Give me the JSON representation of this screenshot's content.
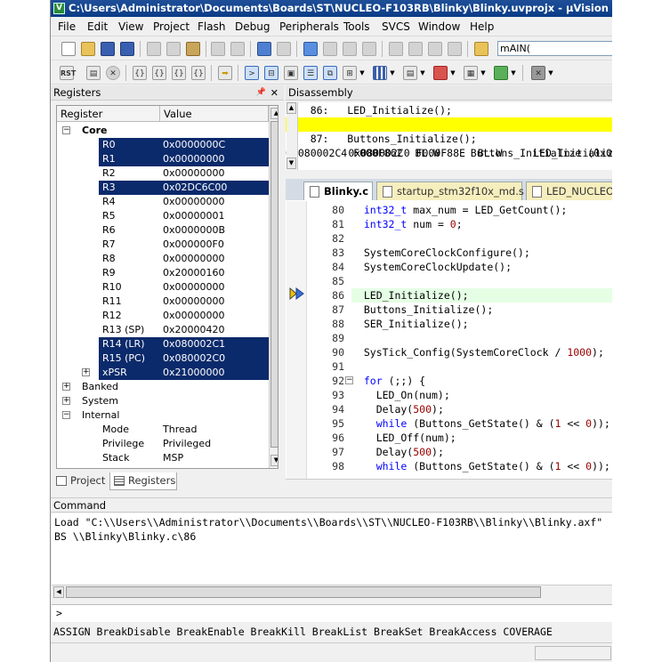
{
  "window": {
    "title": "C:\\Users\\Administrator\\Documents\\Boards\\ST\\NUCLEO-F103RB\\Blinky\\Blinky.uvprojx - µVision"
  },
  "menu": [
    "File",
    "Edit",
    "View",
    "Project",
    "Flash",
    "Debug",
    "Peripherals",
    "Tools",
    "SVCS",
    "Window",
    "Help"
  ],
  "toolbar": {
    "find_value": "mAIN(",
    "reset_label": "RST"
  },
  "registers_panel": {
    "title": "Registers",
    "col_register": "Register",
    "col_value": "Value",
    "core_label": "Core",
    "core": [
      {
        "name": "R0",
        "value": "0x0000000C",
        "selected": true
      },
      {
        "name": "R1",
        "value": "0x00000000",
        "selected": true
      },
      {
        "name": "R2",
        "value": "0x00000000",
        "selected": false
      },
      {
        "name": "R3",
        "value": "0x02DC6C00",
        "selected": true
      },
      {
        "name": "R4",
        "value": "0x00000000",
        "selected": false
      },
      {
        "name": "R5",
        "value": "0x00000001",
        "selected": false
      },
      {
        "name": "R6",
        "value": "0x0000000B",
        "selected": false
      },
      {
        "name": "R7",
        "value": "0x000000F0",
        "selected": false
      },
      {
        "name": "R8",
        "value": "0x00000000",
        "selected": false
      },
      {
        "name": "R9",
        "value": "0x20000160",
        "selected": false
      },
      {
        "name": "R10",
        "value": "0x00000000",
        "selected": false
      },
      {
        "name": "R11",
        "value": "0x00000000",
        "selected": false
      },
      {
        "name": "R12",
        "value": "0x00000000",
        "selected": false
      },
      {
        "name": "R13 (SP)",
        "value": "0x20000420",
        "selected": false
      },
      {
        "name": "R14 (LR)",
        "value": "0x080002C1",
        "selected": true
      },
      {
        "name": "R15 (PC)",
        "value": "0x080002C0",
        "selected": true
      },
      {
        "name": "xPSR",
        "value": "0x21000000",
        "selected": true
      }
    ],
    "groups": [
      "Banked",
      "System",
      "Internal"
    ],
    "internal": [
      {
        "name": "Mode",
        "value": "Thread"
      },
      {
        "name": "Privilege",
        "value": "Privileged"
      },
      {
        "name": "Stack",
        "value": "MSP"
      }
    ],
    "tabs": [
      "Project",
      "Registers"
    ]
  },
  "disassembly": {
    "title": "Disassembly",
    "lines": [
      "    86:   LED_Initialize();",
      "0x080002C0 F000F88E  BL.W     LED_Initialize (0x080003E0)",
      "    87:   Buttons_Initialize();",
      "0x080002C4 F000F862  BL.W     Buttons_Initialize (0x0800038C)"
    ]
  },
  "editor": {
    "tabs": [
      "Blinky.c",
      "startup_stm32f10x_md.s",
      "LED_NUCLEO_F103RB.c"
    ],
    "lines": [
      {
        "n": "80",
        "t": "  int32_t max_num = LED_GetCount();"
      },
      {
        "n": "81",
        "t": "  int32_t num = 0;"
      },
      {
        "n": "82",
        "t": ""
      },
      {
        "n": "83",
        "t": "  SystemCoreClockConfigure();"
      },
      {
        "n": "84",
        "t": "  SystemCoreClockUpdate();"
      },
      {
        "n": "85",
        "t": ""
      },
      {
        "n": "86",
        "t": "  LED_Initialize();"
      },
      {
        "n": "87",
        "t": "  Buttons_Initialize();"
      },
      {
        "n": "88",
        "t": "  SER_Initialize();"
      },
      {
        "n": "89",
        "t": ""
      },
      {
        "n": "90",
        "t": "  SysTick_Config(SystemCoreClock / 1000);"
      },
      {
        "n": "91",
        "t": ""
      },
      {
        "n": "92",
        "t": "  for (;;) {"
      },
      {
        "n": "93",
        "t": "    LED_On(num);"
      },
      {
        "n": "94",
        "t": "    Delay(500);"
      },
      {
        "n": "95",
        "t": "    while (Buttons_GetState() & (1 << 0));"
      },
      {
        "n": "96",
        "t": "    LED_Off(num);"
      },
      {
        "n": "97",
        "t": "    Delay(500);"
      },
      {
        "n": "98",
        "t": "    while (Buttons_GetState() & (1 << 0));"
      }
    ]
  },
  "command": {
    "title": "Command",
    "output": "Load \"C:\\\\Users\\\\Administrator\\\\Documents\\\\Boards\\\\ST\\\\NUCLEO-F103RB\\\\Blinky\\\\Blinky.axf\"\nBS \\\\Blinky\\Blinky.c\\86",
    "prompt": ">",
    "hint": "ASSIGN BreakDisable BreakEnable BreakKill BreakList BreakSet BreakAccess COVERAGE"
  }
}
